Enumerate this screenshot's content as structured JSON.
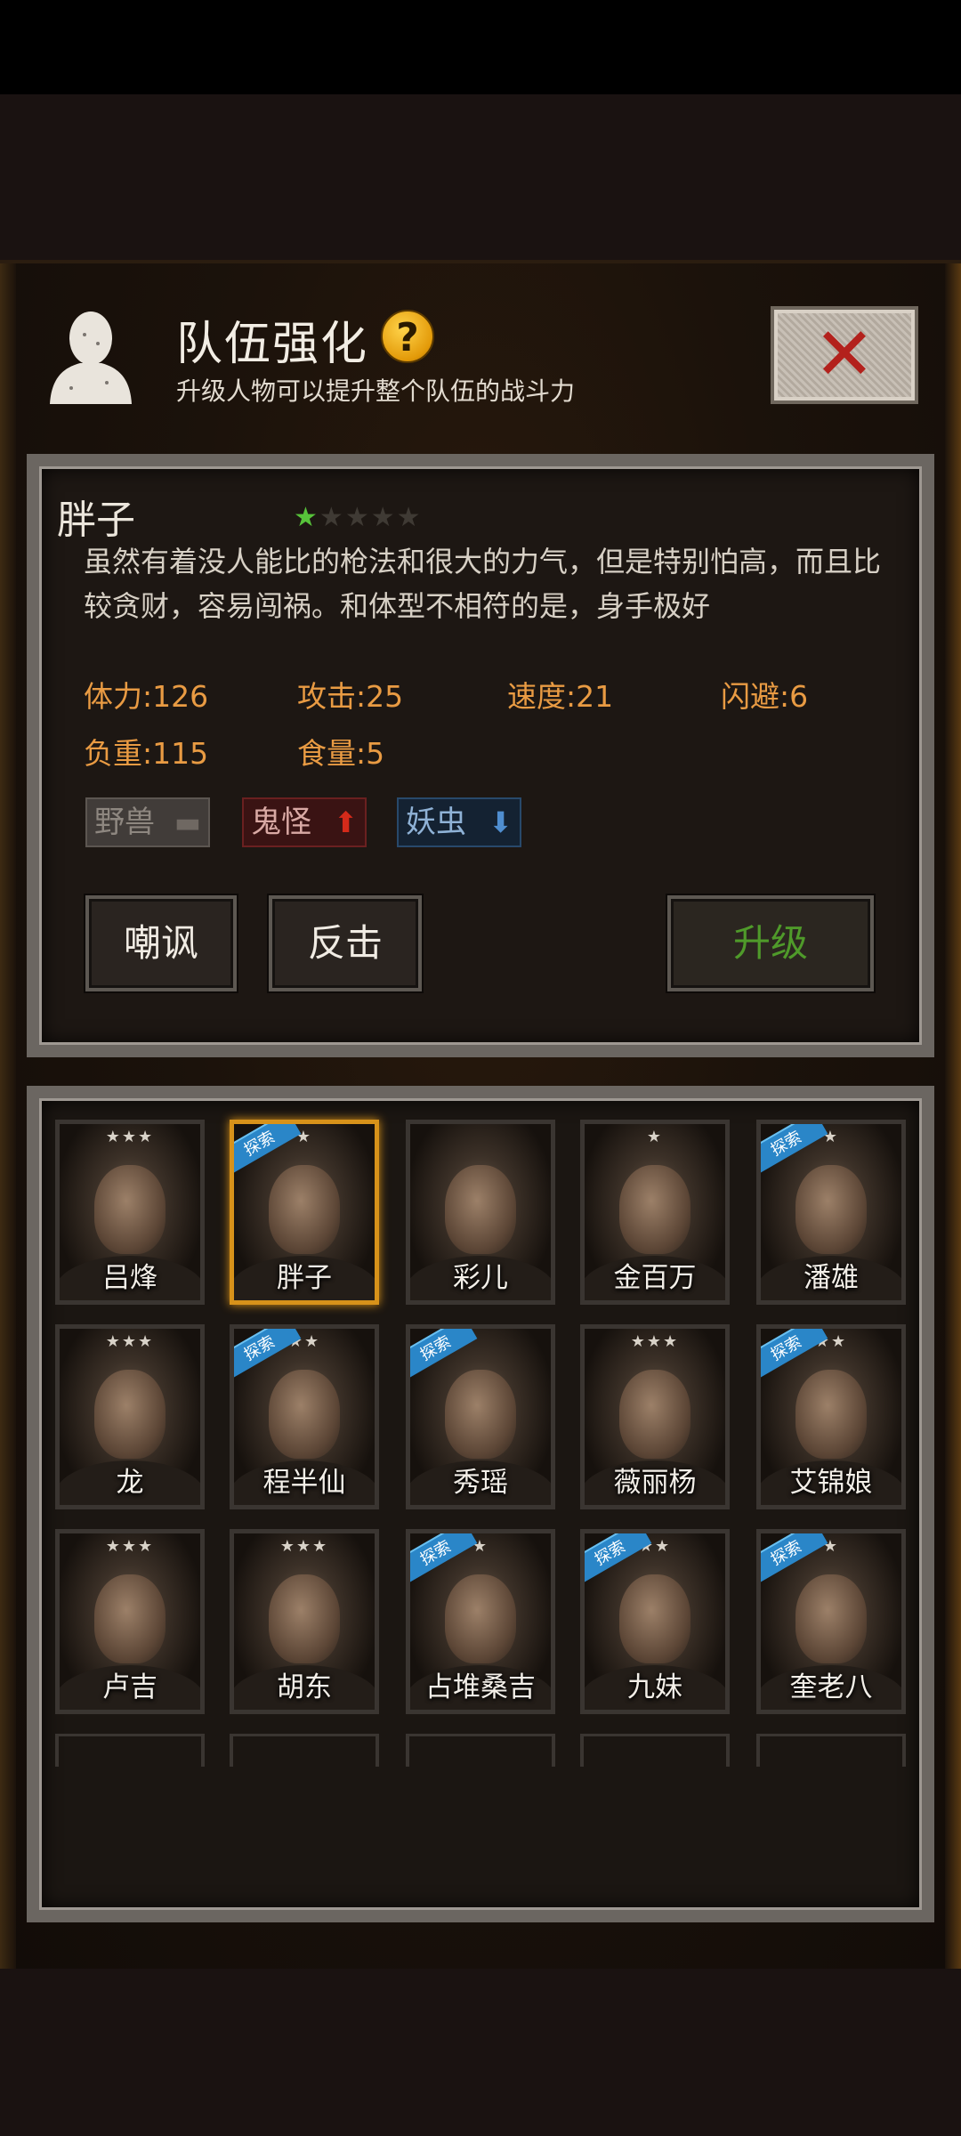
{
  "header": {
    "title": "队伍强化",
    "subtitle": "升级人物可以提升整个队伍的战斗力",
    "help_label": "?"
  },
  "selected_character": {
    "name": "胖子",
    "stars_filled": 1,
    "stars_total": 5,
    "description": "虽然有着没人能比的枪法和很大的力气，但是特别怕高，而且比较贪财，容易闯祸。和体型不相符的是，身手极好",
    "stats": [
      {
        "label": "体力:",
        "value": "126"
      },
      {
        "label": "攻击:",
        "value": "25"
      },
      {
        "label": "速度:",
        "value": "21"
      },
      {
        "label": "闪避:",
        "value": "6"
      },
      {
        "label": "负重:",
        "value": "115"
      },
      {
        "label": "食量:",
        "value": "5"
      }
    ],
    "tags": [
      {
        "label": "野兽",
        "indicator": "neutral"
      },
      {
        "label": "鬼怪",
        "indicator": "up"
      },
      {
        "label": "妖虫",
        "indicator": "down"
      }
    ]
  },
  "actions": {
    "taunt_label": "嘲讽",
    "counter_label": "反击",
    "upgrade_label": "升级"
  },
  "roster": [
    {
      "name": "吕烽",
      "stars": "★★★",
      "explore": false
    },
    {
      "name": "胖子",
      "stars": "★",
      "explore": true,
      "selected": true
    },
    {
      "name": "彩儿",
      "stars": "",
      "explore": false
    },
    {
      "name": "金百万",
      "stars": "★",
      "explore": false
    },
    {
      "name": "潘雄",
      "stars": "★",
      "explore": true
    },
    {
      "name": "龙",
      "stars": "★★★",
      "explore": false
    },
    {
      "name": "程半仙",
      "stars": "★★",
      "explore": true
    },
    {
      "name": "秀瑶",
      "stars": "",
      "explore": true
    },
    {
      "name": "薇丽杨",
      "stars": "★★★",
      "explore": false
    },
    {
      "name": "艾锦娘",
      "stars": "★★",
      "explore": true
    },
    {
      "name": "卢吉",
      "stars": "★★★",
      "explore": false
    },
    {
      "name": "胡东",
      "stars": "★★★",
      "explore": false
    },
    {
      "name": "占堆桑吉",
      "stars": "★",
      "explore": true
    },
    {
      "name": "九妹",
      "stars": "★★",
      "explore": true
    },
    {
      "name": "奎老八",
      "stars": "★",
      "explore": true
    }
  ],
  "explore_badge_label": "探索",
  "close_icon": "close-x-icon",
  "colors": {
    "stat_text": "#e99b43",
    "upgrade_text": "#4f9a2a",
    "star_active": "#57c23a",
    "selected_border": "#d7921a",
    "explore_badge": "#2a86c8"
  }
}
